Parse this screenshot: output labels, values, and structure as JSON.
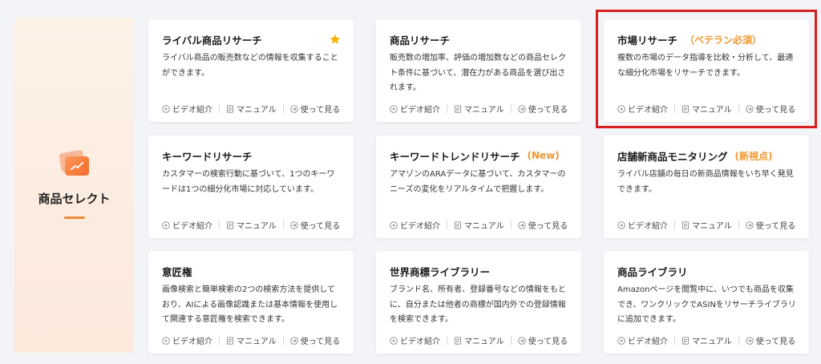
{
  "category": {
    "title": "商品セレクト",
    "icon": "product-chart-icon",
    "accent": "#f08a38"
  },
  "actions": {
    "video": "ビデオ紹介",
    "manual": "マニュアル",
    "try": "使って見る"
  },
  "colors": {
    "tag": "#f0962e",
    "star": "#f5b400",
    "highlight": "#d81e1e"
  },
  "cards": [
    {
      "title": "ライバル商品リサーチ",
      "tag": "",
      "starred": true,
      "description": "ライバル商品の販売数などの情報を収集することができます。"
    },
    {
      "title": "商品リサーチ",
      "tag": "",
      "description": "販売数の増加率、評価の増加数などの商品セレクト条件に基づいて、潜在力がある商品を選び出されます。"
    },
    {
      "title": "市場リサーチ",
      "tag": "（ベテラン必須）",
      "highlighted": true,
      "description": "複数の市場のデータ指導を比較・分析して、最適な細分化市場をリサーチできます。"
    },
    {
      "title": "キーワードリサーチ",
      "tag": "",
      "description": "カスタマーの検索行動に基づいて、1つのキーワードは1つの細分化市場に対応しています。"
    },
    {
      "title": "キーワードトレンドリサーチ",
      "tag": "(New)",
      "description": "アマゾンのARAデータに基づいて、カスタマーのニーズの変化をリアルタイムで把握します。"
    },
    {
      "title": "店舗新商品モニタリング",
      "tag": "(新視点)",
      "description": "ライバル店舗の毎日の新商品情報をいち早く発見できます。"
    },
    {
      "title": "意匠権",
      "tag": "",
      "description": "画像検索と簡単検索の2つの検索方法を提供しており、AIによる画像認識または基本情報を使用して関連する意匠権を検索できます。"
    },
    {
      "title": "世界商標ライブラリー",
      "tag": "",
      "description": "ブランド名、所有者、登録番号などの情報をもとに、自分または他者の商標が国内外での登録情報を検索できます。"
    },
    {
      "title": "商品ライブラリ",
      "tag": "",
      "description": "Amazonページを閲覧中に、いつでも商品を収集でき、ワンクリックでASINをリサーチライブラリに追加できます。"
    }
  ]
}
